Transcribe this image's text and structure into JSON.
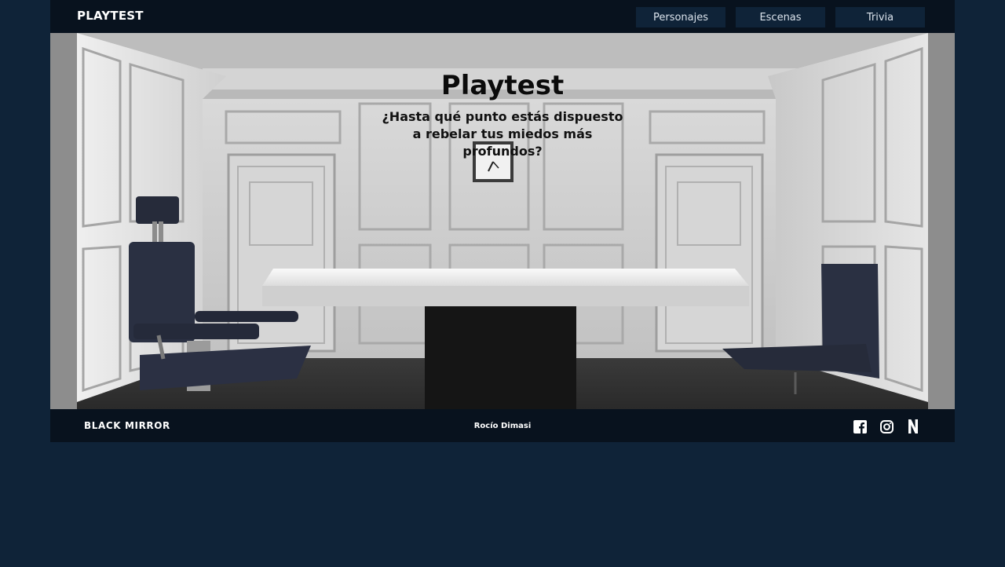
{
  "header": {
    "brand": "PLAYTEST",
    "nav": [
      {
        "label": "Personajes"
      },
      {
        "label": "Escenas"
      },
      {
        "label": "Trivia"
      }
    ]
  },
  "hero": {
    "title": "Playtest",
    "subtitle": "¿Hasta qué punto estás dispuesto a rebelar tus miedos más profundos?"
  },
  "footer": {
    "logo": "BLACK MIRROR",
    "author": "Rocío Dimasi",
    "socials": [
      {
        "icon": "facebook-icon"
      },
      {
        "icon": "instagram-icon"
      },
      {
        "icon": "netflix-icon"
      }
    ]
  },
  "colors": {
    "page_bg": "#0f2338",
    "bar_bg": "#08121e",
    "nav_button_bg": "#0f2338"
  }
}
